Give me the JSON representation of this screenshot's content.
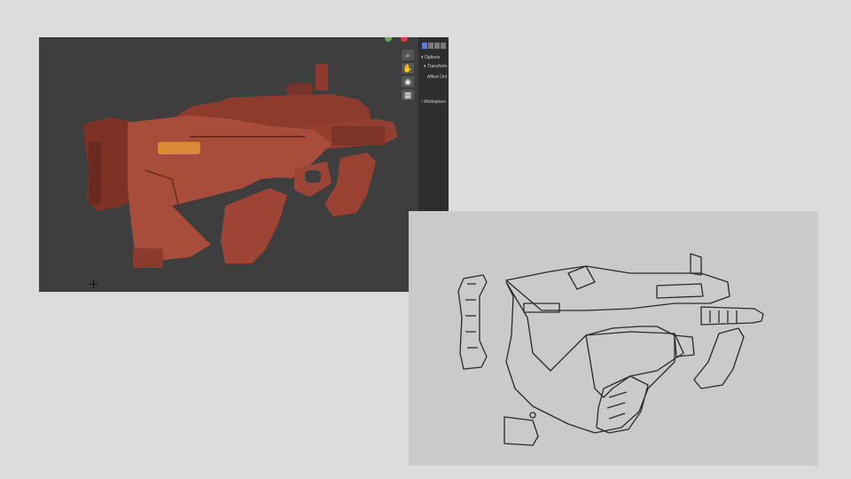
{
  "viewport": {
    "background": "#3e3e3e",
    "model_color": "#a84d3b",
    "panel": {
      "options_label": "Options",
      "transform_label": "Transform",
      "affect_label": "Affect Onl",
      "workspace_label": "Workspace"
    },
    "tools": [
      "zoom-icon",
      "hand-icon",
      "camera-icon",
      "grid-icon"
    ],
    "gizmo_colors": [
      "#6aa84f",
      "#d04040"
    ]
  },
  "sketch": {
    "background": "#c8cbc9",
    "line_color": "#2a2a2a"
  }
}
